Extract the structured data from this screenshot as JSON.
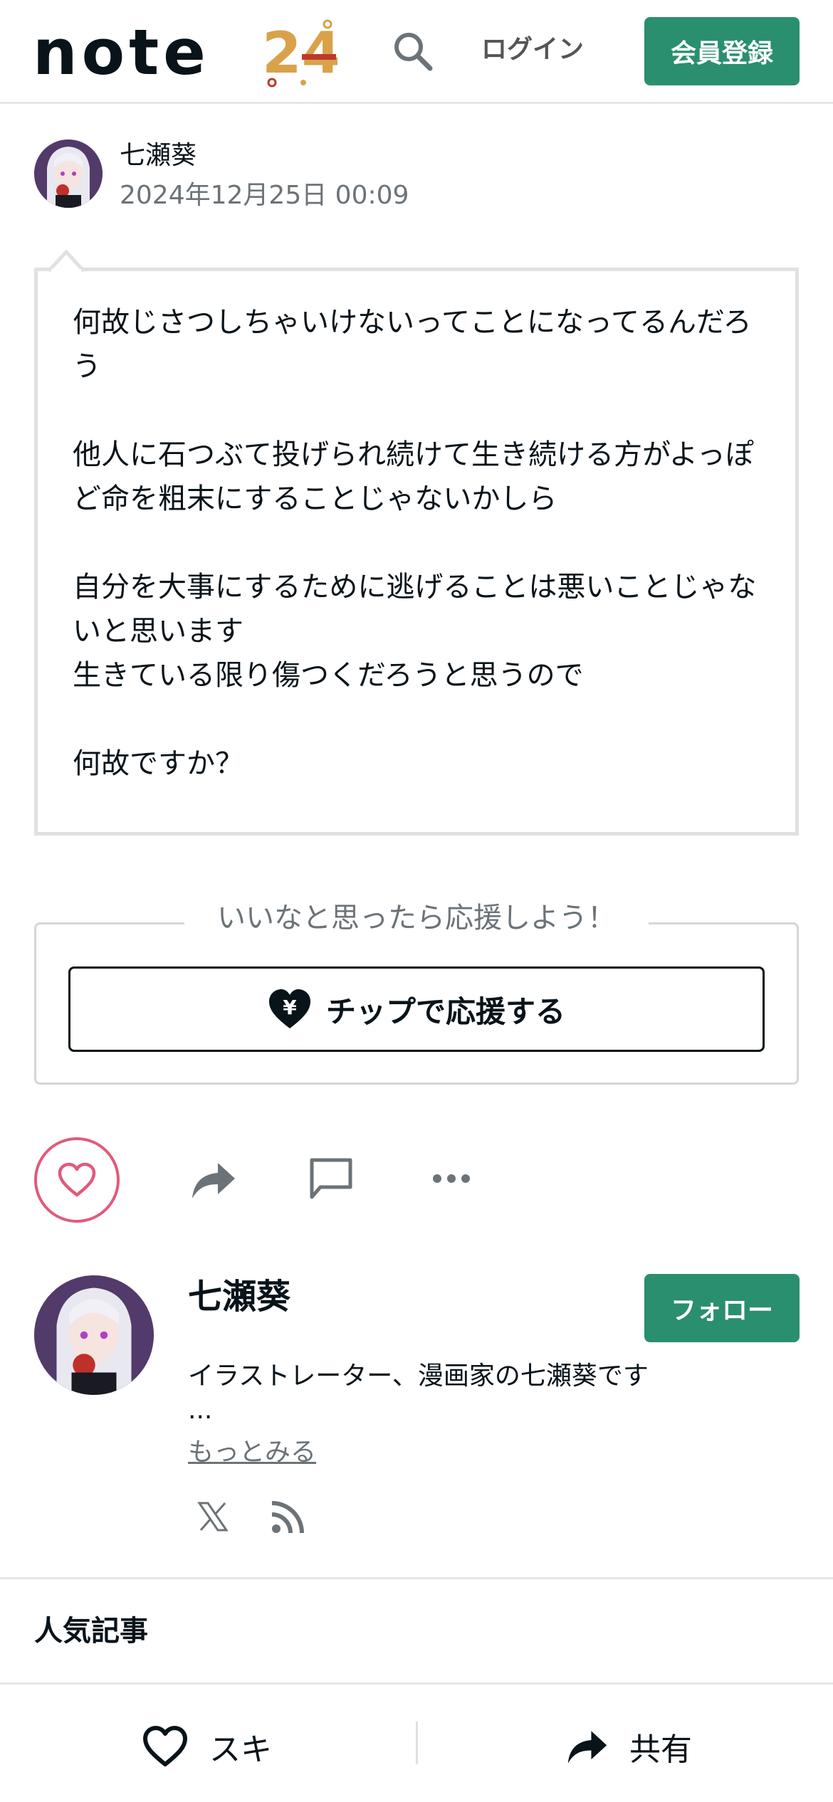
{
  "header": {
    "logo_text": "note",
    "logo_badge": "24",
    "login_label": "ログイン",
    "signup_label": "会員登録",
    "search_icon": "search-icon"
  },
  "post": {
    "author": "七瀬葵",
    "date": "2024年12月25日 00:09",
    "body": "何故じさつしちゃいけないってことになってるんだろう\n\n他人に石つぶて投げられ続けて生き続ける方がよっぽど命を粗末にすることじゃないかしら\n\n自分を大事にするために逃げることは悪いことじゃないと思います\n生きている限り傷つくだろうと思うので\n\n何故ですか？"
  },
  "support": {
    "caption": "いいなと思ったら応援しよう！",
    "tip_label": "チップで応援する"
  },
  "actions": {
    "like_icon": "heart-icon",
    "share_icon": "share-icon",
    "comment_icon": "comment-icon",
    "more_icon": "more-icon"
  },
  "profile": {
    "name": "七瀬葵",
    "follow_label": "フォロー",
    "bio": "イラストレーター、漫画家の七瀬葵です",
    "ellipsis": "...",
    "more_label": "もっとみる",
    "social_icons": [
      "x-icon",
      "rss-icon"
    ]
  },
  "popular": {
    "title": "人気記事"
  },
  "bottom_bar": {
    "like_label": "スキ",
    "share_label": "共有"
  },
  "colors": {
    "accent": "#2a8f6f",
    "like": "#e05b7a",
    "text": "#08131a",
    "muted": "#6b7378"
  }
}
